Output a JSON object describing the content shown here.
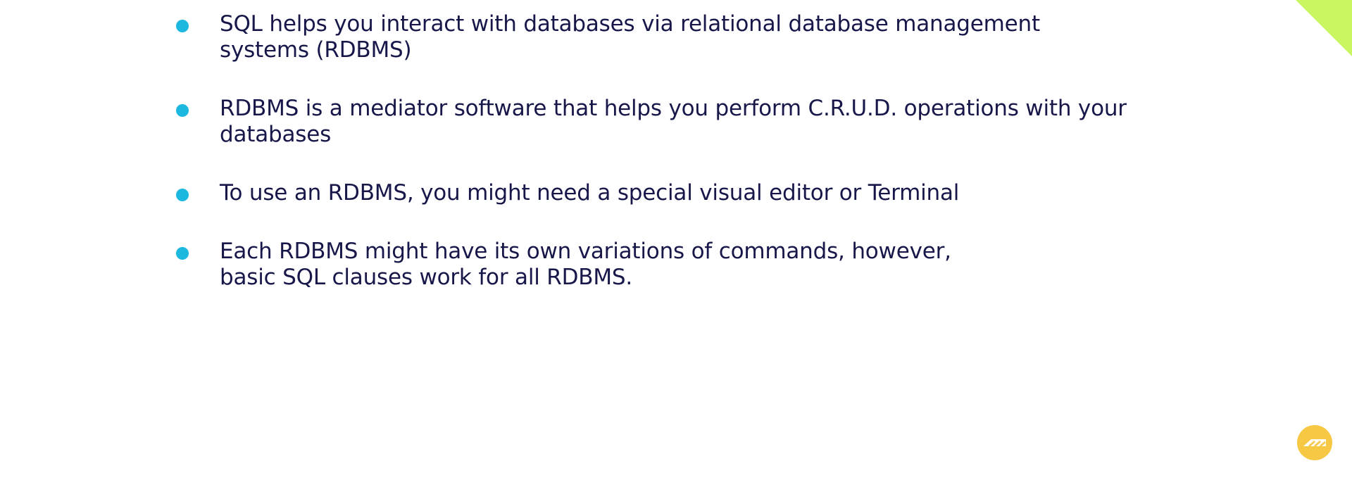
{
  "colors": {
    "text": "#17174a",
    "bullet": "#1db8e0",
    "accent_corner": "#c8f560",
    "badge": "#f6c844"
  },
  "bullets": [
    {
      "lines": [
        "SQL helps you interact with databases via relational database management",
        "systems (RDBMS)"
      ]
    },
    {
      "lines": [
        "RDBMS is a mediator software that helps you perform C.R.U.D. operations with your",
        "databases"
      ]
    },
    {
      "lines": [
        "To use an RDBMS, you might need a special visual editor or Terminal"
      ]
    },
    {
      "lines": [
        "Each RDBMS might have its own variations of commands, however,",
        "basic SQL clauses work for all RDBMS."
      ]
    }
  ],
  "badge": {
    "icon": "logo-icon"
  }
}
